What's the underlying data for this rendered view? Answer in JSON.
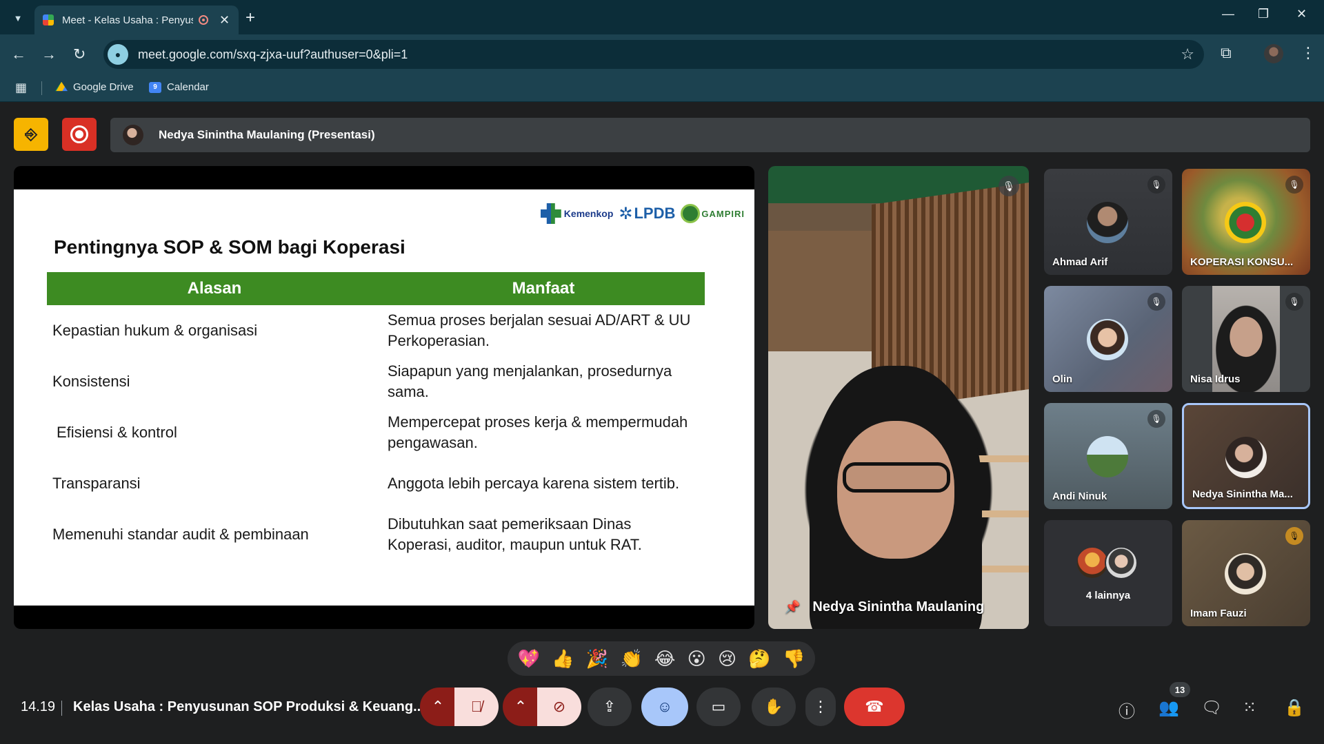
{
  "browser": {
    "tab_title": "Meet - Kelas Usaha : Penyusunan SOP",
    "url": "meet.google.com/sxq-zjxa-uuf?authuser=0&pli=1",
    "bookmarks": [
      "Google Drive",
      "Calendar"
    ],
    "calendar_day": "9"
  },
  "meet": {
    "presenter_label": "Nedya Sinintha Maulaning (Presentasi)",
    "slide": {
      "title": "Pentingnya SOP & SOM bagi Koperasi",
      "logos": [
        "Kemenkop",
        "LPDB",
        "GAMPIRI"
      ],
      "columns": [
        "Alasan",
        "Manfaat"
      ],
      "rows": [
        {
          "alasan": "Kepastian hukum & organisasi",
          "manfaat": "Semua proses berjalan sesuai AD/ART & UU Perkoperasian."
        },
        {
          "alasan": "Konsistensi",
          "manfaat": "Siapapun yang menjalankan, prosedurnya sama."
        },
        {
          "alasan": "Efisiensi & kontrol",
          "manfaat": "Mempercepat proses kerja & mempermudah pengawasan."
        },
        {
          "alasan": "Transparansi",
          "manfaat": "Anggota lebih percaya karena sistem tertib."
        },
        {
          "alasan": "Memenuhi standar audit & pembinaan",
          "manfaat": "Dibutuhkan saat pemeriksaan Dinas Koperasi, auditor, maupun untuk RAT."
        }
      ]
    },
    "main_speaker": "Nedya Sinintha Maulaning",
    "participants": [
      {
        "name": "Ahmad Arif"
      },
      {
        "name": "KOPERASI KONSU..."
      },
      {
        "name": "Olin"
      },
      {
        "name": "Nisa Idrus"
      },
      {
        "name": "Andi Ninuk"
      },
      {
        "name": "Nedya Sinintha Ma..."
      },
      {
        "name": "4 lainnya"
      },
      {
        "name": "Imam Fauzi"
      }
    ],
    "reactions": [
      "💖",
      "👍",
      "🎉",
      "👏",
      "😂",
      "😮",
      "😢",
      "🤔",
      "👎"
    ],
    "time": "14.19",
    "meeting_title": "Kelas Usaha : Penyusunan SOP Produksi & Keuang...",
    "participant_count": "13"
  }
}
